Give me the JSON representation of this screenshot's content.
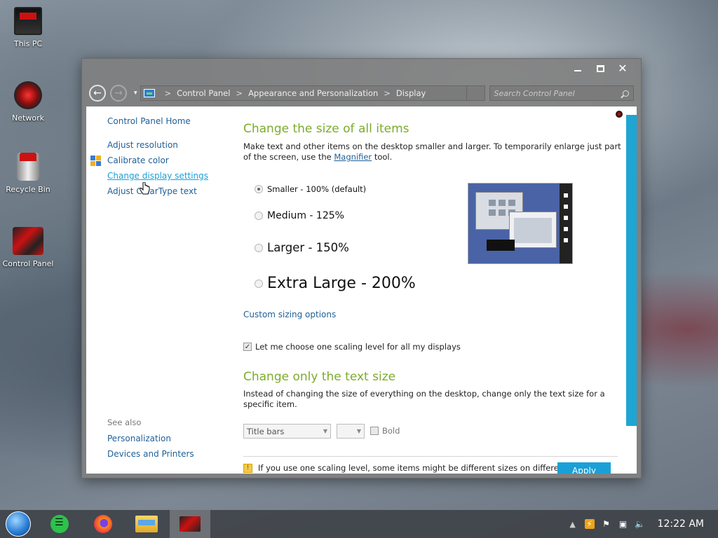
{
  "desktop": {
    "icons": [
      {
        "label": "This PC"
      },
      {
        "label": "Network"
      },
      {
        "label": "Recycle Bin"
      },
      {
        "label": "Control Panel"
      }
    ]
  },
  "window": {
    "controls": {
      "minimize": "—",
      "maximize": "□",
      "close": "✕"
    },
    "nav": {
      "back": "←",
      "forward": "→",
      "recent": "▾"
    },
    "breadcrumb": [
      "Control Panel",
      "Appearance and Personalization",
      "Display"
    ],
    "breadcrumb_sep": ">",
    "search": {
      "placeholder": "Search Control Panel"
    },
    "sidebar": {
      "home": "Control Panel Home",
      "links": [
        "Adjust resolution",
        "Calibrate color",
        "Change display settings",
        "Adjust ClearType text"
      ],
      "active_link": "Change display settings",
      "see_also_label": "See also",
      "see_also_links": [
        "Personalization",
        "Devices and Printers"
      ]
    },
    "main": {
      "heading_size": "Change the size of all items",
      "desc_part1": "Make text and other items on the desktop smaller and larger. To temporarily enlarge just part of the screen, use the ",
      "magnifier_link": "Magnifier",
      "desc_part2": " tool.",
      "options": [
        {
          "label": "Smaller - 100% (default)",
          "checked": true
        },
        {
          "label": "Medium - 125%",
          "checked": false
        },
        {
          "label": "Larger - 150%",
          "checked": false
        },
        {
          "label": "Extra Large - 200%",
          "checked": false
        }
      ],
      "custom_sizing": "Custom sizing options",
      "scaling_checkbox": {
        "label": "Let me choose one scaling level for all my displays",
        "checked": true
      },
      "heading_text": "Change only the text size",
      "text_desc": "Instead of changing the size of everything on the desktop, change only the text size for a specific item.",
      "item_select": "Title bars",
      "size_select": "",
      "bold_label": "Bold",
      "warning": "If you use one scaling level, some items might be different sizes on different",
      "apply": "Apply"
    }
  },
  "taskbar": {
    "clock": "12:22 AM"
  }
}
